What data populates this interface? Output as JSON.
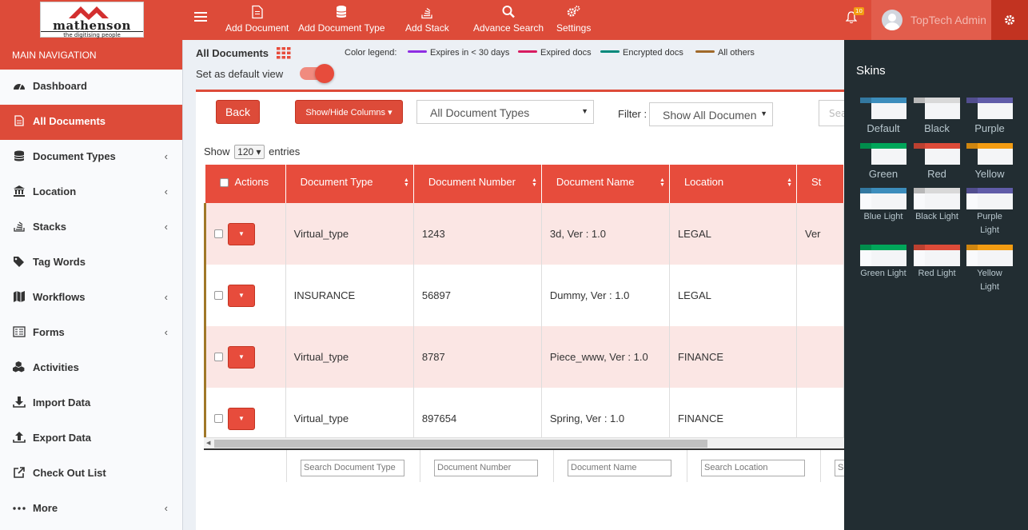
{
  "header": {
    "logo_text": "mathenson",
    "logo_tagline": "the digitising people",
    "nav": [
      {
        "label": "Add Document",
        "icon": "file-icon"
      },
      {
        "label": "Add Document Type",
        "icon": "database-icon"
      },
      {
        "label": "Add Stack",
        "icon": "stack-icon"
      },
      {
        "label": "Advance Search",
        "icon": "search-icon"
      },
      {
        "label": "Settings",
        "icon": "cogs-icon"
      }
    ],
    "notification_count": "10",
    "user_name": "TopTech Admin"
  },
  "sidebar": {
    "header": "MAIN NAVIGATION",
    "items": [
      {
        "label": "Dashboard",
        "icon": "dashboard-icon",
        "has_children": false
      },
      {
        "label": "All Documents",
        "icon": "document-icon",
        "has_children": false,
        "active": true
      },
      {
        "label": "Document Types",
        "icon": "database-icon",
        "has_children": true
      },
      {
        "label": "Location",
        "icon": "bank-icon",
        "has_children": true
      },
      {
        "label": "Stacks",
        "icon": "stack-icon",
        "has_children": true
      },
      {
        "label": "Tag Words",
        "icon": "tag-icon",
        "has_children": false
      },
      {
        "label": "Workflows",
        "icon": "map-icon",
        "has_children": true
      },
      {
        "label": "Forms",
        "icon": "form-icon",
        "has_children": true
      },
      {
        "label": "Activities",
        "icon": "cubes-icon",
        "has_children": false
      },
      {
        "label": "Import Data",
        "icon": "download-icon",
        "has_children": false
      },
      {
        "label": "Export Data",
        "icon": "upload-icon",
        "has_children": false
      },
      {
        "label": "Check Out List",
        "icon": "external-link-icon",
        "has_children": false
      },
      {
        "label": "More",
        "icon": "ellipsis-icon",
        "has_children": true
      }
    ]
  },
  "main": {
    "title": "All Documents",
    "color_legend_label": "Color legend:",
    "legend": [
      {
        "label": "Expires in < 30 days",
        "color": "#8e2de2"
      },
      {
        "label": "Expired docs",
        "color": "#d81b60"
      },
      {
        "label": "Encrypted docs",
        "color": "#00897b"
      },
      {
        "label": "All others",
        "color": "#a0692a"
      }
    ],
    "default_view_label": "Set as default view",
    "default_view_on": true,
    "back_label": "Back",
    "show_hide_label": "Show/Hide Columns",
    "doc_type_select": "All Document Types",
    "filter_label": "Filter :",
    "filter_select": "Show All Documen",
    "search_placeholder": "Search",
    "show_label": "Show",
    "page_size": "120",
    "entries_label": "entries",
    "columns": [
      "Actions",
      "Document Type",
      "Document Number",
      "Document Name",
      "Location",
      "St"
    ],
    "rows": [
      {
        "type": "Virtual_type",
        "number": "1243",
        "name": "3d, Ver : 1.0",
        "location": "LEGAL",
        "status": "Ver"
      },
      {
        "type": "INSURANCE",
        "number": "56897",
        "name": "Dummy, Ver : 1.0",
        "location": "LEGAL",
        "status": ""
      },
      {
        "type": "Virtual_type",
        "number": "8787",
        "name": "Piece_www, Ver : 1.0",
        "location": "FINANCE",
        "status": ""
      },
      {
        "type": "Virtual_type",
        "number": "897654",
        "name": "Spring, Ver : 1.0",
        "location": "FINANCE",
        "status": ""
      }
    ],
    "footer_search": [
      "Search Document Type",
      "Document Number",
      "Document Name",
      "Search  Location",
      "Se"
    ]
  },
  "skins": {
    "title": "Skins",
    "items": [
      {
        "label": "Default",
        "header": "#3c8dbc",
        "side": "#222d32"
      },
      {
        "label": "Black",
        "header": "#d9d9d9",
        "side": "#222d32"
      },
      {
        "label": "Purple",
        "header": "#605ca8",
        "side": "#222d32"
      },
      {
        "label": "Green",
        "header": "#00a65a",
        "side": "#222d32"
      },
      {
        "label": "Red",
        "header": "#dd4b39",
        "side": "#222d32"
      },
      {
        "label": "Yellow",
        "header": "#f39c12",
        "side": "#222d32"
      },
      {
        "label": "Blue Light",
        "header": "#3c8dbc",
        "side": "#f9fafc"
      },
      {
        "label": "Black Light",
        "header": "#d9d9d9",
        "side": "#f9fafc"
      },
      {
        "label": "Purple Light",
        "header": "#605ca8",
        "side": "#f9fafc"
      },
      {
        "label": "Green Light",
        "header": "#00a65a",
        "side": "#f9fafc"
      },
      {
        "label": "Red Light",
        "header": "#dd4b39",
        "side": "#f9fafc"
      },
      {
        "label": "Yellow Light",
        "header": "#f39c12",
        "side": "#f9fafc"
      }
    ]
  },
  "colors": {
    "accent": "#dd4b39",
    "row_tint": "#fbe6e4",
    "row_border": "#a0692a"
  }
}
